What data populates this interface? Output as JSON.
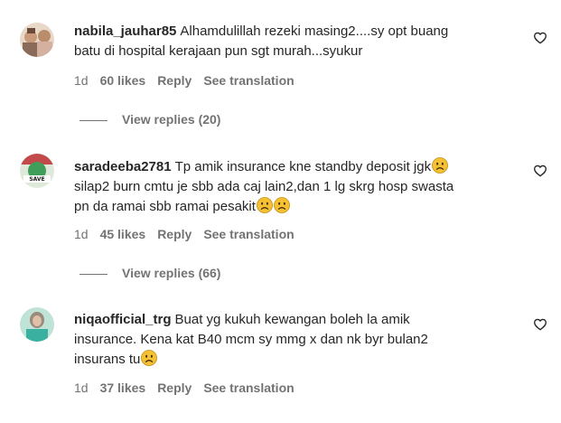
{
  "comments": [
    {
      "username": "nabila_jauhar85",
      "text_lines": [
        "Alhamdulillah rezeki masing2....sy opt buang",
        "batu di hospital kerajaan pun sgt murah...syukur"
      ],
      "time": "1d",
      "likes": "60 likes",
      "reply_label": "Reply",
      "translate_label": "See translation",
      "view_replies": "View replies (20)"
    },
    {
      "username": "saradeeba2781",
      "text_lines": [
        "Tp amik insurance kne standby deposit jgk",
        "silap2 burn cmtu je sbb ada caj lain2,dan 1 lg skrg hosp swasta",
        "pn da ramai sbb ramai pesakit"
      ],
      "time": "1d",
      "likes": "45 likes",
      "reply_label": "Reply",
      "translate_label": "See translation",
      "view_replies": "View replies (66)"
    },
    {
      "username": "niqaofficial_trg",
      "text_lines": [
        "Buat yg kukuh kewangan boleh la amik",
        "insurance. Kena kat B40 mcm sy mmg x dan nk byr bulan2",
        "insurans tu"
      ],
      "time": "1d",
      "likes": "37 likes",
      "reply_label": "Reply",
      "translate_label": "See translation"
    }
  ],
  "icons": {
    "like": "heart-outline-icon",
    "emoji": "sad-face-emoji"
  },
  "colors": {
    "text": "#262626",
    "secondary": "#737373",
    "emoji": "#f5c032"
  }
}
